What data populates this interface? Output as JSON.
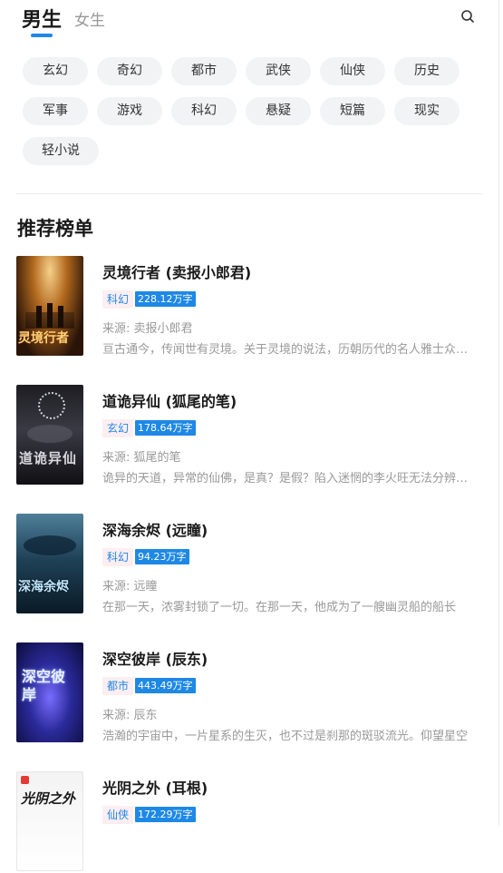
{
  "header": {
    "tab_male": "男生",
    "tab_female": "女生"
  },
  "tags": [
    "玄幻",
    "奇幻",
    "都市",
    "武侠",
    "仙侠",
    "历史",
    "军事",
    "游戏",
    "科幻",
    "悬疑",
    "短篇",
    "现实",
    "轻小说"
  ],
  "section_title": "推荐榜单",
  "books": [
    {
      "title": "灵境行者 (卖报小郎君)",
      "genre": "科幻",
      "words": "228.12万字",
      "source": "来源: 卖报小郎君",
      "summary": "亘古通今，传闻世有灵境。关于灵境的说法，历朝历代的名人雅士众说纷纭",
      "cover_text": "灵境行者"
    },
    {
      "title": "道诡异仙 (狐尾的笔)",
      "genre": "玄幻",
      "words": "178.64万字",
      "source": "来源: 狐尾的笔",
      "summary": "诡异的天道，异常的仙佛，是真？是假？陷入迷惘的李火旺无法分辨真假",
      "cover_text": "道诡异仙"
    },
    {
      "title": "深海余烬 (远瞳)",
      "genre": "科幻",
      "words": "94.23万字",
      "source": "来源: 远瞳",
      "summary": "在那一天，浓雾封锁了一切。在那一天，他成为了一艘幽灵船的船长",
      "cover_text": "深海余烬"
    },
    {
      "title": "深空彼岸 (辰东)",
      "genre": "都市",
      "words": "443.49万字",
      "source": "来源: 辰东",
      "summary": "浩瀚的宇宙中，一片星系的生灭，也不过是刹那的斑驳流光。仰望星空",
      "cover_text": "深空彼岸"
    },
    {
      "title": "光阴之外 (耳根)",
      "genre": "仙侠",
      "words": "172.29万字",
      "source": "",
      "summary": "",
      "cover_text": "光阴之外"
    }
  ],
  "colors": {
    "accent": "#1e88e5",
    "tag_bg": "#f1f3f5",
    "genre_bg": "#fdeef2"
  }
}
